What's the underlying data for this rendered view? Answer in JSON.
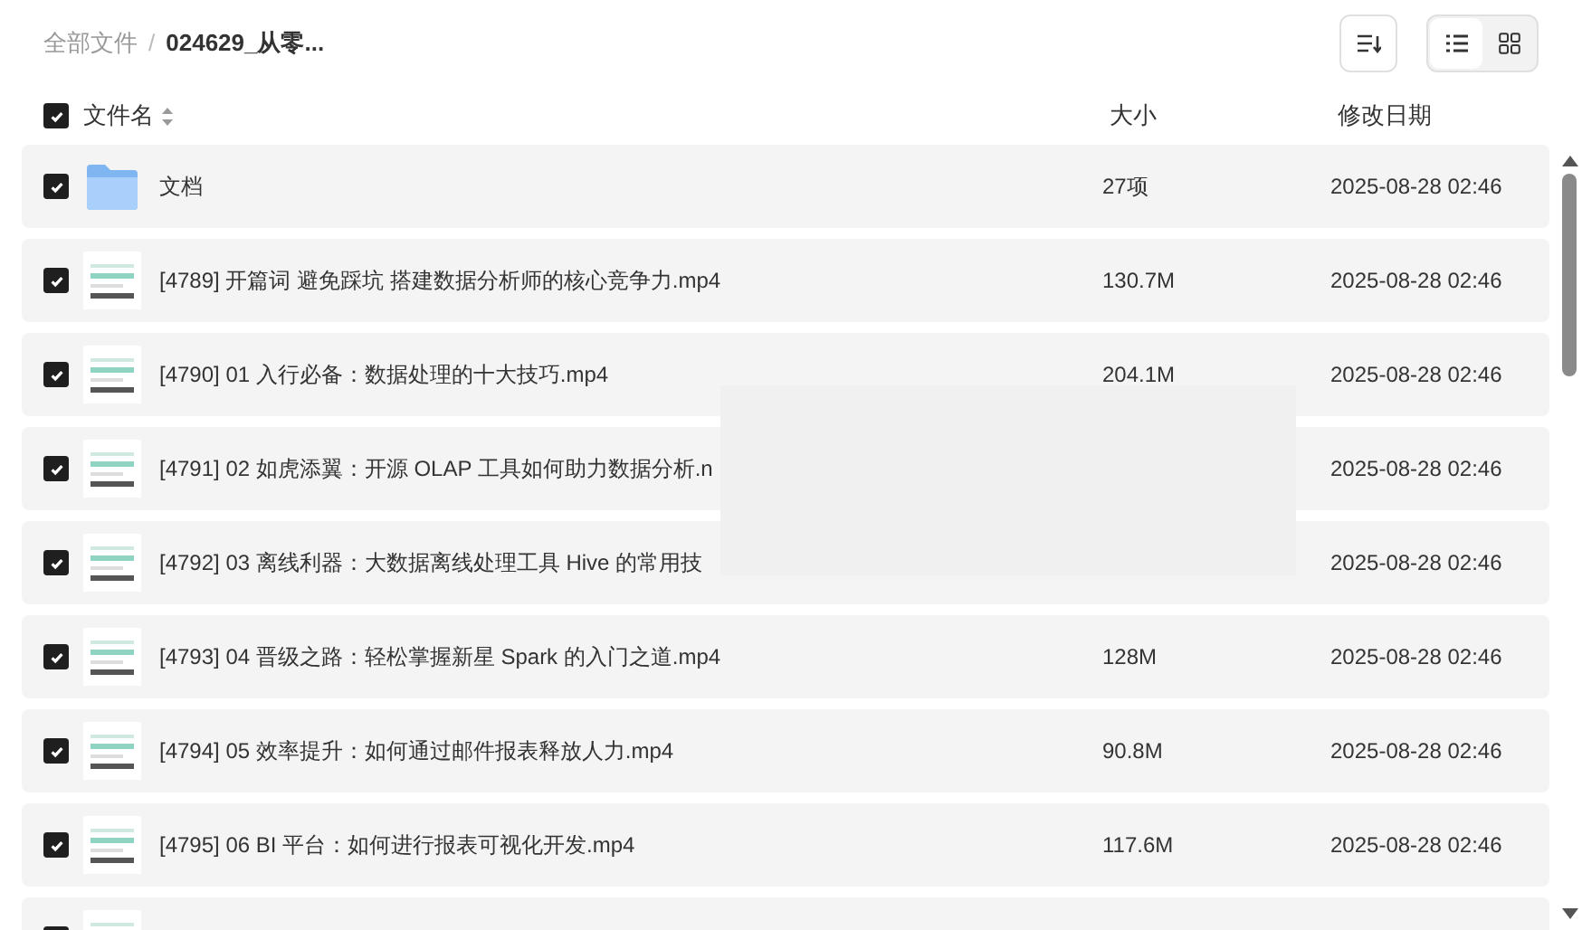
{
  "breadcrumb": [
    {
      "label": "全部文件",
      "current": false
    },
    {
      "separator": "/"
    },
    {
      "label": "024629_从零...",
      "current": true
    }
  ],
  "view_toggle": [
    {
      "kind": "list",
      "selected": true
    },
    {
      "kind": "grid",
      "selected": false
    }
  ],
  "columns": {
    "select_all": true,
    "name": "文件名",
    "size": "大小",
    "modified": "修改日期"
  },
  "rows": [
    {
      "kind": "folder",
      "checked": true,
      "name": "文档",
      "size": "27项",
      "modified": "2025-08-28 02:46"
    },
    {
      "kind": "video",
      "checked": true,
      "name": "[4789] 开篇词 避免踩坑 搭建数据分析师的核心竞争力.mp4",
      "size": "130.7M",
      "modified": "2025-08-28 02:46"
    },
    {
      "kind": "video",
      "checked": true,
      "name": "[4790] 01 入行必备：数据处理的十大技巧.mp4",
      "size": "204.1M",
      "modified": "2025-08-28 02:46"
    },
    {
      "kind": "video",
      "checked": true,
      "name": "[4791] 02 如虎添翼：开源 OLAP 工具如何助力数据分析.n",
      "modified": "2025-08-28 02:46"
    },
    {
      "kind": "video",
      "checked": true,
      "name": "[4792] 03 离线利器：大数据离线处理工具 Hive 的常用技",
      "modified": "2025-08-28 02:46"
    },
    {
      "kind": "video",
      "checked": true,
      "name": "[4793] 04 晋级之路：轻松掌握新星 Spark 的入门之道.mp4",
      "size": "128M",
      "modified": "2025-08-28 02:46"
    },
    {
      "kind": "video",
      "checked": true,
      "name": "[4794] 05 效率提升：如何通过邮件报表释放人力.mp4",
      "size": "90.8M",
      "modified": "2025-08-28 02:46"
    },
    {
      "kind": "video",
      "checked": true,
      "name": "[4795] 06 BI 平台：如何进行报表可视化开发.mp4",
      "size": "117.6M",
      "modified": "2025-08-28 02:46"
    },
    {
      "kind": "video",
      "checked": true
    }
  ]
}
